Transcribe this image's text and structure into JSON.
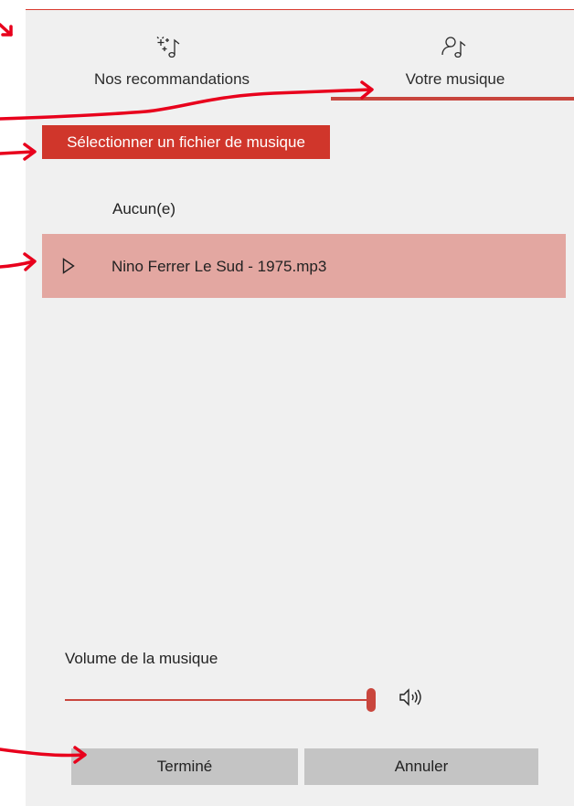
{
  "tabs": [
    {
      "label": "Nos recommandations",
      "icon": "sparkle-music-icon"
    },
    {
      "label": "Votre musique",
      "icon": "person-music-icon"
    }
  ],
  "select_button_label": "Sélectionner un fichier de musique",
  "music_list": {
    "none_label": "Aucun(e)",
    "selected_track": "Nino Ferrer  Le Sud  - 1975.mp3"
  },
  "volume": {
    "label": "Volume de la musique",
    "level": 1.0
  },
  "actions": {
    "done_label": "Terminé",
    "cancel_label": "Annuler"
  },
  "colors": {
    "accent": "#d0362b",
    "selected_row": "#e3a7a1",
    "panel_bg": "#f0f0f0",
    "annotation_arrow": "#e8001c"
  }
}
